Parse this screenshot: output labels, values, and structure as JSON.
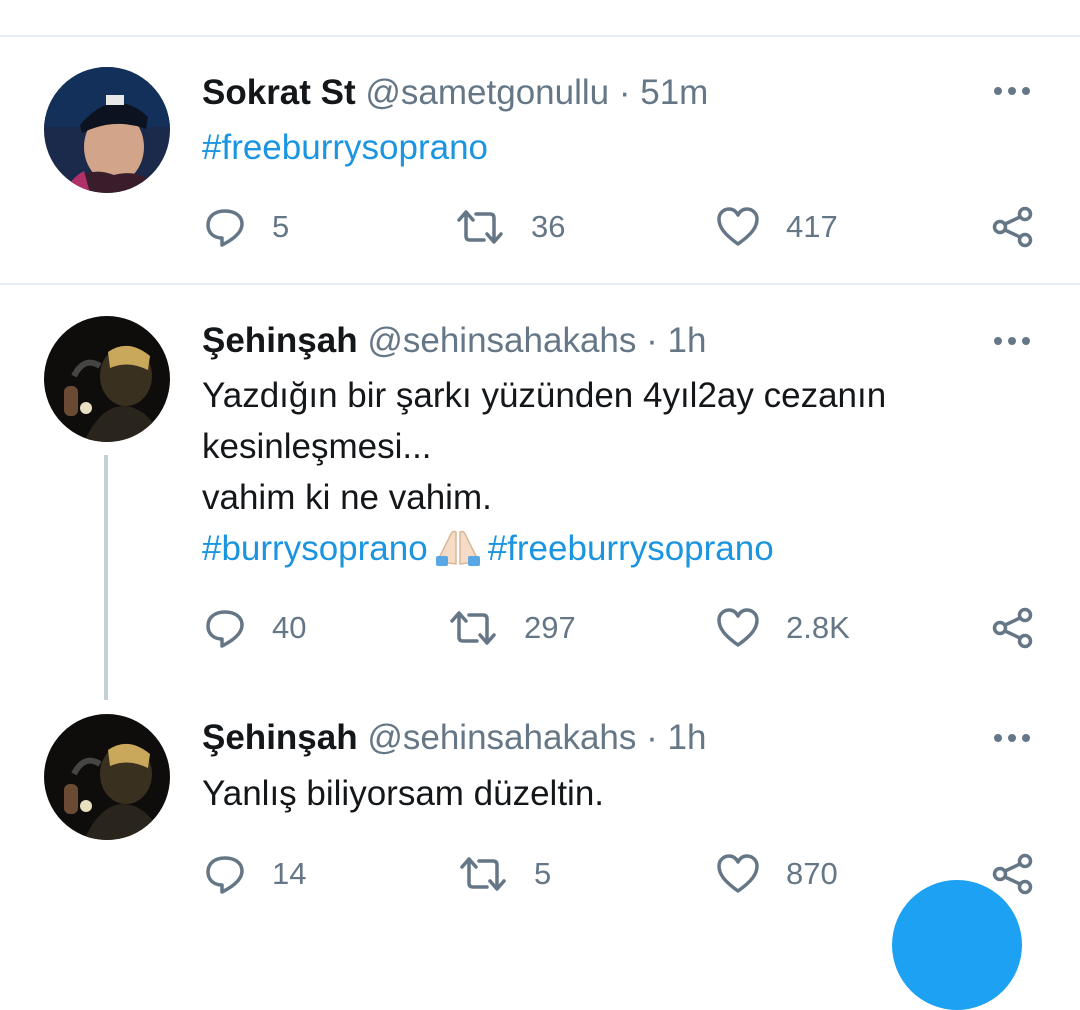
{
  "tweets": [
    {
      "name": "Sokrat St",
      "handle": "@sametgonullu",
      "separator": "·",
      "time": "51m",
      "lines": [],
      "hashtag_line": [
        "#freeburrysoprano"
      ],
      "replies": "5",
      "retweets": "36",
      "likes": "417"
    },
    {
      "name": "Şehinşah",
      "handle": "@sehinsahakahs",
      "separator": "·",
      "time": "1h",
      "lines": [
        "Yazdığın bir şarkı yüzünden 4yıl2ay cezanın",
        "kesinleşmesi...",
        "vahim ki ne vahim."
      ],
      "hashtag_line": [
        "#burrysoprano",
        "#freeburrysoprano"
      ],
      "emoji": "folded-hands-emoji",
      "replies": "40",
      "retweets": "297",
      "likes": "2.8K"
    },
    {
      "name": "Şehinşah",
      "handle": "@sehinsahakahs",
      "separator": "·",
      "time": "1h",
      "lines": [
        "Yanlış biliyorsam düzeltin."
      ],
      "hashtag_line": [],
      "replies": "14",
      "retweets": "5",
      "likes": "870"
    }
  ],
  "colors": {
    "hashtag": "#1b95e0",
    "secondary_text": "#657786",
    "fab": "#1da1f2"
  },
  "icons": [
    "reply-icon",
    "retweet-icon",
    "like-icon",
    "share-icon",
    "more-icon",
    "folded-hands-emoji"
  ]
}
